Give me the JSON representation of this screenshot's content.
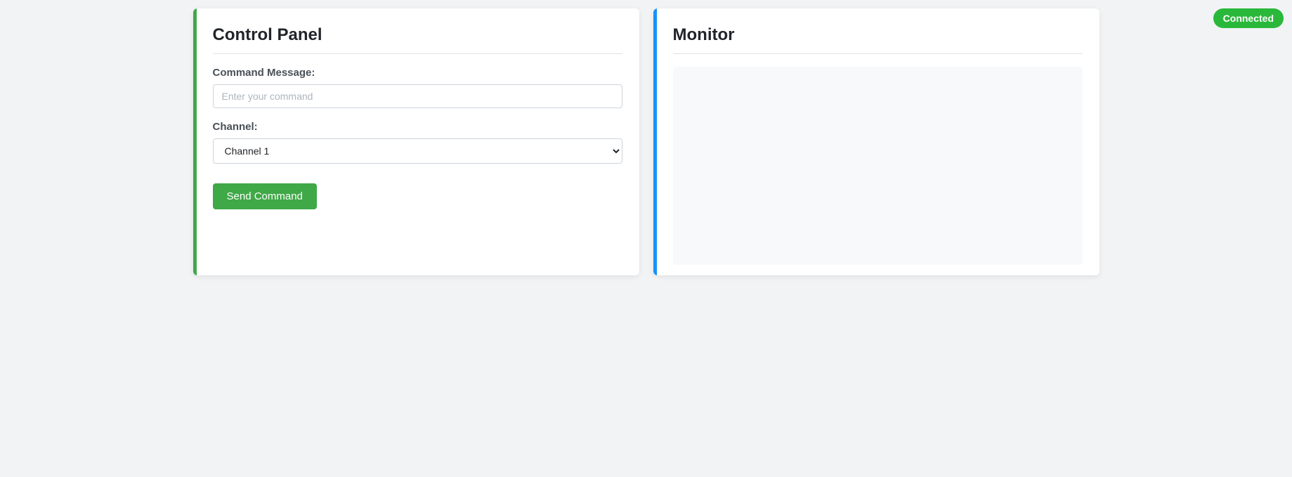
{
  "status": {
    "label": "Connected"
  },
  "control_panel": {
    "title": "Control Panel",
    "command_label": "Command Message:",
    "command_placeholder": "Enter your command",
    "command_value": "",
    "channel_label": "Channel:",
    "channel_selected": "Channel 1",
    "send_button_label": "Send Command"
  },
  "monitor": {
    "title": "Monitor"
  }
}
